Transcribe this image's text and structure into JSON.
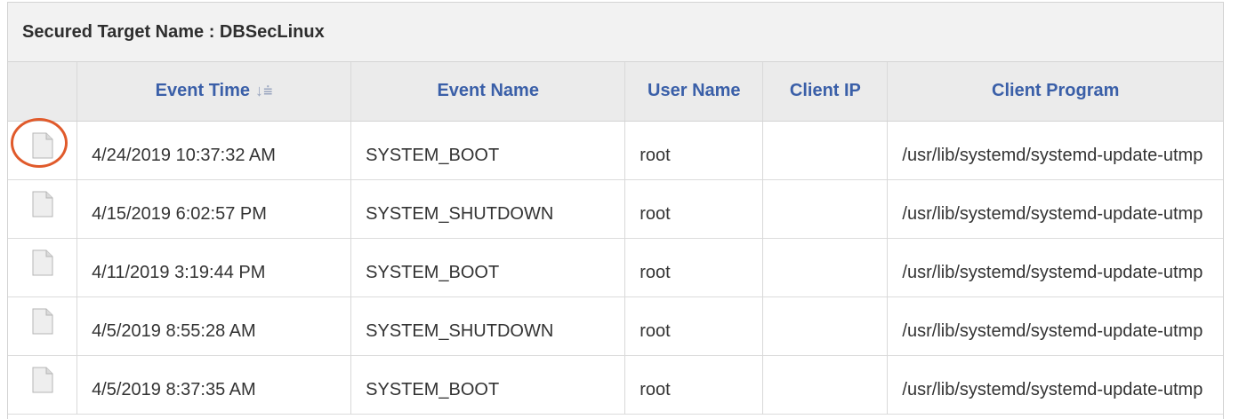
{
  "panel": {
    "title": "Secured Target Name : DBSecLinux"
  },
  "table": {
    "columns": [
      {
        "key": "icon",
        "label": ""
      },
      {
        "key": "event_time",
        "label": "Event Time",
        "sort_icon": "sort-descending-icon"
      },
      {
        "key": "event_name",
        "label": "Event Name"
      },
      {
        "key": "user_name",
        "label": "User Name"
      },
      {
        "key": "client_ip",
        "label": "Client IP"
      },
      {
        "key": "client_program",
        "label": "Client Program"
      }
    ],
    "rows": [
      {
        "icon": "document-icon",
        "event_time": "4/24/2019 10:37:32 AM",
        "event_name": "SYSTEM_BOOT",
        "user_name": "root",
        "client_ip": "",
        "client_program": "/usr/lib/systemd/systemd-update-utmp",
        "highlighted": true
      },
      {
        "icon": "document-icon",
        "event_time": "4/15/2019 6:02:57 PM",
        "event_name": "SYSTEM_SHUTDOWN",
        "user_name": "root",
        "client_ip": "",
        "client_program": "/usr/lib/systemd/systemd-update-utmp"
      },
      {
        "icon": "document-icon",
        "event_time": "4/11/2019 3:19:44 PM",
        "event_name": "SYSTEM_BOOT",
        "user_name": "root",
        "client_ip": "",
        "client_program": "/usr/lib/systemd/systemd-update-utmp"
      },
      {
        "icon": "document-icon",
        "event_time": "4/5/2019 8:55:28 AM",
        "event_name": "SYSTEM_SHUTDOWN",
        "user_name": "root",
        "client_ip": "",
        "client_program": "/usr/lib/systemd/systemd-update-utmp"
      },
      {
        "icon": "document-icon",
        "event_time": "4/5/2019 8:37:35 AM",
        "event_name": "SYSTEM_BOOT",
        "user_name": "root",
        "client_ip": "",
        "client_program": "/usr/lib/systemd/systemd-update-utmp"
      }
    ]
  },
  "colors": {
    "header_link": "#3a5fa8",
    "highlight": "#e05a2b",
    "header_bg": "#ebebeb"
  }
}
